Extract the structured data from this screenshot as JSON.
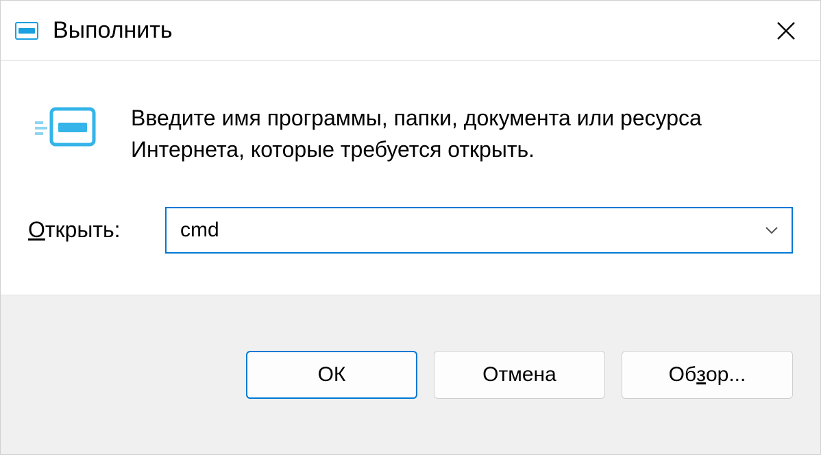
{
  "titlebar": {
    "title": "Выполнить"
  },
  "content": {
    "description": "Введите имя программы, папки, документа или ресурса Интернета, которые требуется открыть.",
    "open_label_prefix": "О",
    "open_label_rest": "ткрыть:",
    "open_value": "cmd"
  },
  "footer": {
    "ok": "ОК",
    "cancel": "Отмена",
    "browse_prefix": "Об",
    "browse_underline": "з",
    "browse_suffix": "ор..."
  }
}
